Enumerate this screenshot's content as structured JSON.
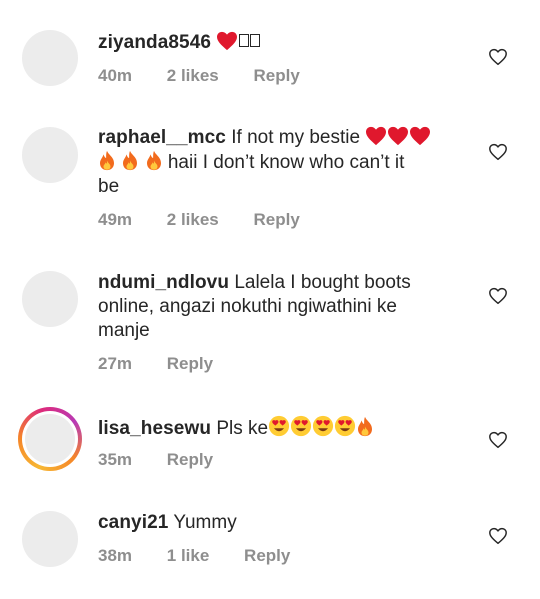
{
  "comments": [
    {
      "username": "ziyanda8546",
      "text": "",
      "time": "40m",
      "likes": "2 likes",
      "reply": "Reply",
      "story_ring": false,
      "emojis": [
        "red-heart",
        "small-box",
        "small-box"
      ]
    },
    {
      "username": "raphael__mcc",
      "text_line1": "If not my bestie",
      "text_line2": "haii I don’t know who can’t it",
      "text_line3": "be",
      "time": "49m",
      "likes": "2 likes",
      "reply": "Reply",
      "story_ring": false,
      "emojis": [
        "red-heart",
        "red-heart",
        "red-heart",
        "fire",
        "fire",
        "fire"
      ]
    },
    {
      "username": "ndumi_ndlovu",
      "text_line1": "Lalela I bought boots",
      "text_line2": "online, angazi nokuthi ngiwathini ke",
      "text_line3": "manje",
      "time": "27m",
      "reply": "Reply",
      "story_ring": false
    },
    {
      "username": "lisa_hesewu",
      "text": "Pls ke",
      "time": "35m",
      "reply": "Reply",
      "story_ring": true,
      "emojis": [
        "heart-eyes",
        "heart-eyes",
        "heart-eyes",
        "heart-eyes",
        "fire"
      ]
    },
    {
      "username": "canyi21",
      "text": "Yummy",
      "time": "38m",
      "likes": "1 like",
      "reply": "Reply",
      "story_ring": false
    }
  ],
  "colors": {
    "text": "#262626",
    "meta": "#8e8e8e",
    "avatar_placeholder": "#ececec",
    "story_ring": [
      "#f58529",
      "#dd2a7b",
      "#b83ab5"
    ]
  },
  "icons": {
    "like": "heart-outline-icon"
  }
}
